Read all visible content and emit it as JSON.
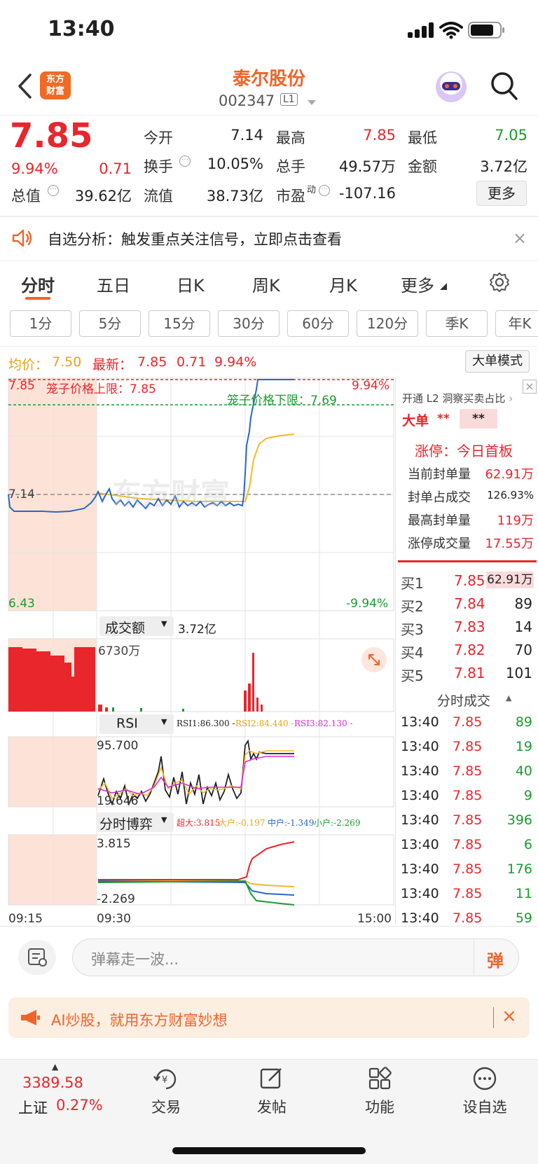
{
  "status_bar": {
    "time": "13:40"
  },
  "header": {
    "logo_line1": "东方",
    "logo_line2": "财富",
    "stock_name": "泰尔股份",
    "stock_code": "002347",
    "level": "L1"
  },
  "quote": {
    "price": "7.85",
    "change_pct": "9.94%",
    "change_amt": "0.71",
    "fields": {
      "open_label": "今开",
      "open": "7.14",
      "high_label": "最高",
      "high": "7.85",
      "low_label": "最低",
      "low": "7.05",
      "turnover_label": "换手",
      "turnover": "10.05%",
      "volume_label": "总手",
      "volume": "49.57万",
      "amount_label": "金额",
      "amount": "3.72亿",
      "mcap_label": "总值",
      "mcap": "39.62亿",
      "float_label": "流值",
      "float": "38.73亿",
      "pe_label": "市盈",
      "pe_sup": "动",
      "pe": "-107.16"
    },
    "more_label": "更多"
  },
  "notice": {
    "text": "自选分析：触发重点关注信号，立即点击查看"
  },
  "tabs": [
    "分时",
    "五日",
    "日K",
    "周K",
    "月K",
    "更多"
  ],
  "active_tab": 0,
  "ktabs": [
    "1分",
    "5分",
    "15分",
    "30分",
    "60分",
    "120分",
    "季K",
    "年K"
  ],
  "chart": {
    "avg_label": "均价：",
    "avg": "7.50",
    "latest_label": "最新：",
    "latest": "7.85",
    "latest_chg": "0.71",
    "latest_pct": "9.94%",
    "big_order_btn": "大单模式",
    "upper_price": "7.85",
    "upper_limit_text": "笼子价格上限：7.85",
    "upper_pct": "9.94%",
    "lower_limit_text": "笼子价格下限：7.69",
    "mid_price": "7.14",
    "watermark": "东方财富",
    "low_price": "6.43",
    "low_pct": "-9.94%",
    "vol_label": "成交额",
    "vol_total": "3.72亿",
    "vol_scale": "6730万",
    "rsi_label": "RSI",
    "rsi1": "RSI1:86.300 -",
    "rsi2": "RSI2:84.440 -",
    "rsi3": "RSI3:82.130 -",
    "rsi_max": "95.700",
    "rsi_min": "19.646",
    "game_label": "分时博弈",
    "game_super": "超大:3.815",
    "game_big": "大户:-0.197",
    "game_mid": "中户:-1.349",
    "game_small": "小户:-2.269",
    "game_max": "3.815",
    "game_min": "-2.269",
    "time_start": "09:15",
    "time_open": "09:30",
    "time_end": "15:00"
  },
  "right_panel": {
    "l2_text": "开通 L2 洞察买卖占比",
    "big_order_label": "大单",
    "big_order_v1": "**",
    "big_order_v2": "**",
    "limit_up_title": "涨停：今日首板",
    "stats": [
      {
        "label": "当前封单量",
        "value": "62.91万"
      },
      {
        "label": "封单占成交",
        "value": "126.93%"
      },
      {
        "label": "最高封单量",
        "value": "119万"
      },
      {
        "label": "涨停成交量",
        "value": "17.55万"
      }
    ],
    "bids": [
      {
        "label": "买1",
        "price": "7.85",
        "qty": "62.91万"
      },
      {
        "label": "买2",
        "price": "7.84",
        "qty": "89"
      },
      {
        "label": "买3",
        "price": "7.83",
        "qty": "14"
      },
      {
        "label": "买4",
        "price": "7.82",
        "qty": "70"
      },
      {
        "label": "买5",
        "price": "7.81",
        "qty": "101"
      }
    ],
    "trades_title": "分时成交",
    "trades": [
      {
        "time": "13:40",
        "price": "7.85",
        "qty": "89"
      },
      {
        "time": "13:40",
        "price": "7.85",
        "qty": "19"
      },
      {
        "time": "13:40",
        "price": "7.85",
        "qty": "40"
      },
      {
        "time": "13:40",
        "price": "7.85",
        "qty": "9"
      },
      {
        "time": "13:40",
        "price": "7.85",
        "qty": "396"
      },
      {
        "time": "13:40",
        "price": "7.85",
        "qty": "6"
      },
      {
        "time": "13:40",
        "price": "7.85",
        "qty": "176"
      },
      {
        "time": "13:40",
        "price": "7.85",
        "qty": "11"
      },
      {
        "time": "13:40",
        "price": "7.85",
        "qty": "59"
      }
    ]
  },
  "danmu": {
    "placeholder": "弹幕走一波...",
    "send": "弹"
  },
  "ai_banner": {
    "text": "AI炒股，就用东方财富妙想"
  },
  "bottom_nav": {
    "index_value": "3389.58",
    "index_name": "上证",
    "index_pct": "0.27%",
    "items": [
      "交易",
      "发帖",
      "功能",
      "设自选"
    ]
  },
  "colors": {
    "up": "#e8262c",
    "down": "#1a9c2e",
    "brand": "#f0642a",
    "price_line": "#2a66c8",
    "avg_line": "#f5b829"
  }
}
